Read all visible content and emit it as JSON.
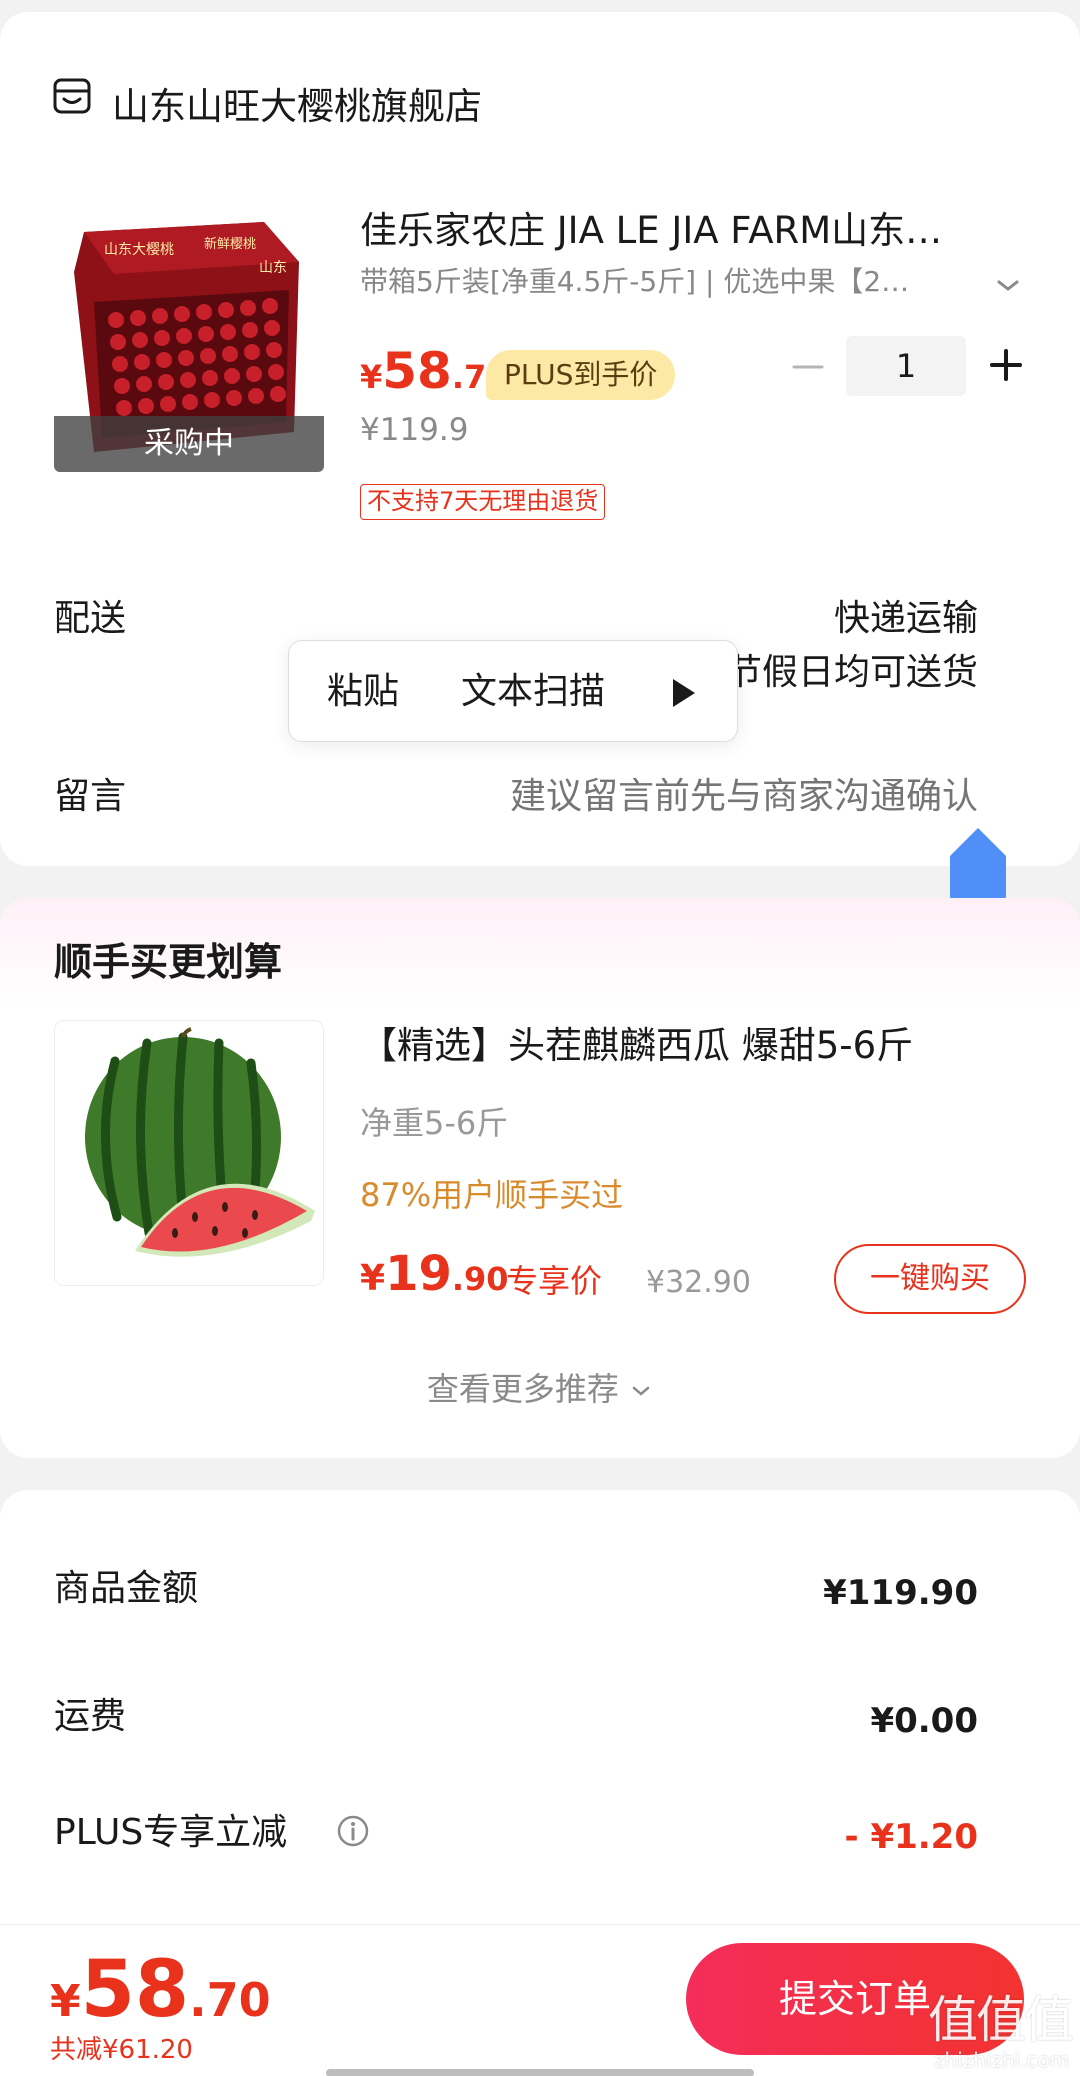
{
  "store": {
    "name": "山东山旺大樱桃旗舰店",
    "icon": "store-icon"
  },
  "product": {
    "title": "佳乐家农庄 JIA LE JIA FARM山东…",
    "spec": "带箱5斤装[净重4.5斤-5斤] | 优选中果【2…",
    "image_caption": "采购中",
    "image_box_text": [
      "山东大樱桃",
      "新鲜樱桃",
      "山东"
    ],
    "price_symbol": "¥",
    "price_int": "58",
    "price_dec": ".7",
    "plus_badge": "PLUS到手价",
    "original_price": "¥119.9",
    "return_policy": "不支持7天无理由退货",
    "quantity": "1"
  },
  "delivery": {
    "label": "配送",
    "value": "快递运输",
    "note": "节假日均可送货"
  },
  "context_menu": {
    "paste": "粘贴",
    "scan": "文本扫描"
  },
  "message": {
    "label": "留言",
    "placeholder": "建议留言前先与商家沟通确认"
  },
  "recommendation": {
    "section_title": "顺手买更划算",
    "name": "【精选】头茬麒麟西瓜 爆甜5-6斤",
    "weight": "净重5-6斤",
    "social_proof": "87%用户顺手买过",
    "price_symbol": "¥",
    "price_int": "19",
    "price_dec": ".90",
    "price_tag": "专享价",
    "original_price": "¥32.90",
    "buy_button": "一键购买",
    "more_link": "查看更多推荐"
  },
  "summary": {
    "goods_amount_label": "商品金额",
    "goods_amount_value": "¥119.90",
    "shipping_label": "运费",
    "shipping_value": "¥0.00",
    "plus_discount_label": "PLUS专享立减",
    "plus_discount_value": "- ¥1.20"
  },
  "checkout": {
    "total_symbol": "¥",
    "total_int": "58",
    "total_dec": ".70",
    "total_discount": "共减¥61.20",
    "submit_label": "提交订单"
  },
  "watermark": {
    "main": "值值值",
    "sub": "zhizhizhi.com"
  },
  "colors": {
    "accent_red": "#e8321c",
    "plus_badge_bg": "#fde9a6",
    "social_proof_orange": "#d98a2b",
    "submit_gradient_start": "#f42d5a",
    "submit_gradient_end": "#f2332f"
  }
}
